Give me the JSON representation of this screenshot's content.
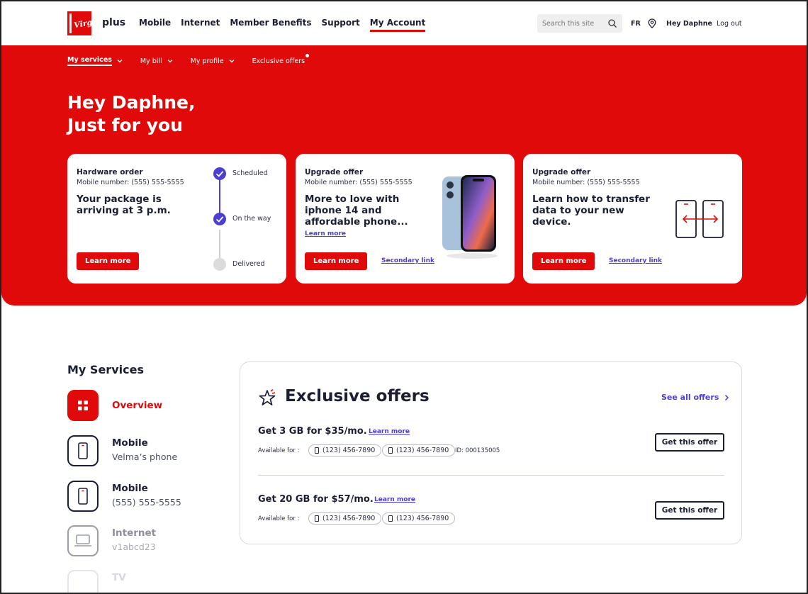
{
  "brand": {
    "plus": "plus",
    "accent": "#e10a0a",
    "link_color": "#4a3fd1"
  },
  "nav": {
    "items": [
      "Mobile",
      "Internet",
      "Member Benefits",
      "Support",
      "My Account"
    ],
    "active": "My Account"
  },
  "search": {
    "placeholder": "Search this site"
  },
  "header": {
    "lang": "FR",
    "greeting": "Hey Daphne",
    "logout": "Log out"
  },
  "subnav": {
    "items": [
      "My services",
      "My bill",
      "My profile",
      "Exclusive offers"
    ],
    "active": "My services"
  },
  "hero": {
    "line1": "Hey Daphne,",
    "line2": "Just for you"
  },
  "cards": [
    {
      "eyebrow": "Hardware order",
      "sub": "Mobile number: (555) 555-5555",
      "headline_1": "Your package is",
      "headline_2": "arriving at 3 p.m.",
      "button": "Learn more",
      "steps": [
        "Scheduled",
        "On the way",
        "Delivered"
      ]
    },
    {
      "eyebrow": "Upgrade offer",
      "sub": "Mobile number: (555) 555-5555",
      "headline_1": "More to love with",
      "headline_2": "iphone 14 and",
      "headline_3": "affordable phone...",
      "inline_link": "Learn more",
      "button": "Learn more",
      "secondary": "Secondary link"
    },
    {
      "eyebrow": "Upgrade offer",
      "sub": "Mobile number: (555) 555-5555",
      "headline_1": "Learn how to transfer",
      "headline_2": "data to your new",
      "headline_3": "device.",
      "button": "Learn more",
      "secondary": "Secondary link"
    }
  ],
  "services": {
    "title": "My Services",
    "items": [
      {
        "name": "Overview",
        "desc": "",
        "icon": "grid-icon"
      },
      {
        "name": "Mobile",
        "desc": "Velma’s phone",
        "icon": "phone-icon"
      },
      {
        "name": "Mobile",
        "desc": "(555) 555-5555",
        "icon": "phone-icon"
      },
      {
        "name": "Internet",
        "desc": "v1abcd23",
        "icon": "laptop-icon"
      },
      {
        "name": "TV",
        "desc": "",
        "icon": "tv-icon"
      }
    ]
  },
  "offers": {
    "title": "Exclusive offers",
    "see_all": "See all offers",
    "available_label": "Available for :",
    "list": [
      {
        "title": "Get 3 GB for $35/mo.",
        "link": "Learn more",
        "numbers": [
          "(123) 456-7890",
          "(123) 456-7890"
        ],
        "id": "ID: 000135005",
        "button": "Get this offer"
      },
      {
        "title": "Get 20 GB for $57/mo.",
        "link": "Learn more",
        "numbers": [
          "(123) 456-7890",
          "(123) 456-7890"
        ],
        "button": "Get this offer"
      }
    ]
  }
}
